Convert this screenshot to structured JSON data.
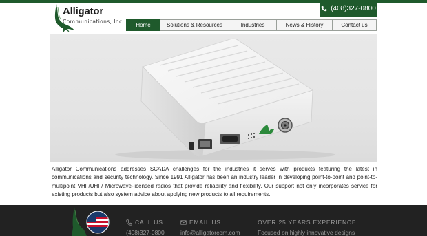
{
  "brand": {
    "name": "Alligator",
    "subtitle": "Communications, Inc"
  },
  "header": {
    "phone_label": "(408)327-0800"
  },
  "nav": {
    "items": [
      {
        "label": "Home",
        "active": true
      },
      {
        "label": "Solutions & Resources",
        "active": false
      },
      {
        "label": "Industries",
        "active": false
      },
      {
        "label": "News & History",
        "active": false
      },
      {
        "label": "Contact us",
        "active": false
      }
    ]
  },
  "hero": {
    "image": "white-radio-modem-device-photo"
  },
  "main": {
    "description": "Alligator Communications addresses SCADA challenges for the industries it serves with products featuring the latest in communications and security technology. Since 1991 Alligator has been an industry leader in developing point-to-point and point-to-multipoint VHF/UHF/ Microwave-licensed radios that provide reliability and flexibility. Our support not only incorporates service for existing products but also system advice about applying new products to all requirements."
  },
  "footer": {
    "call": {
      "heading": "CALL US",
      "value": "(408)327-0800",
      "icon": "phone-icon"
    },
    "email": {
      "heading": "EMAIL US",
      "value": "info@alligatorcom.com",
      "icon": "envelope-icon"
    },
    "experience": {
      "heading": "OVER 25 YEARS EXPERIENCE",
      "value": "Focused on highly innovative designs"
    }
  },
  "colors": {
    "brand_green": "#1f5a2c",
    "footer_bg": "#222222",
    "footer_text": "#9a9a9a",
    "nav_bg": "#f4f4f4"
  }
}
